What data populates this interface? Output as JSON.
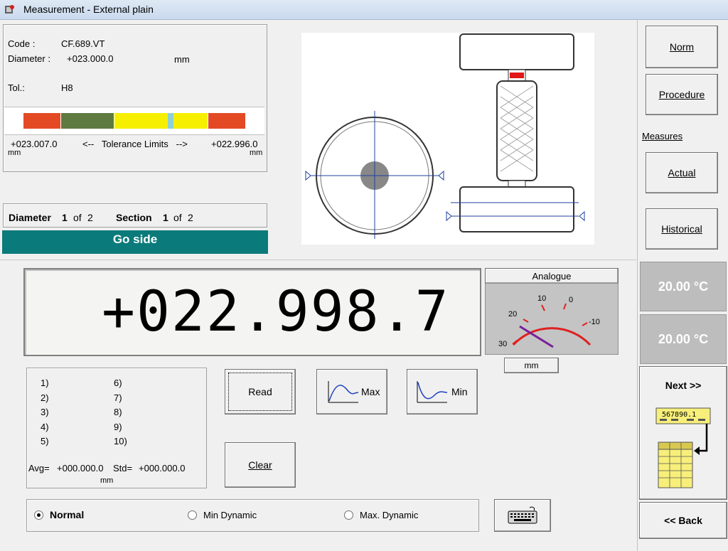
{
  "window": {
    "title": "Measurement - External plain"
  },
  "part": {
    "code_label": "Code :",
    "code_value": "CF.689.VT",
    "diameter_label": "Diameter :",
    "diameter_value": "+023.000.0",
    "diameter_unit": "mm",
    "tol_label": "Tol.:",
    "tol_value": "H8"
  },
  "tolerance": {
    "left_value": "+023.007.0",
    "left_unit": "mm",
    "middle_label": "<--   Tolerance Limits   -->",
    "right_value": "+022.996.0",
    "right_unit": "mm",
    "colors": {
      "red": "#e34a24",
      "green": "#5e7a41",
      "yellow": "#f7ef00",
      "cyan": "#8ed0d4",
      "frame": "#ffffff"
    }
  },
  "section": {
    "diameter_label": "Diameter",
    "diameter_num": "1",
    "of1": "of",
    "diameter_total": "2",
    "section_label": "Section",
    "section_num": "1",
    "of2": "of",
    "section_total": "2"
  },
  "go_side": {
    "label": "Go side",
    "color": "#0b7a7a"
  },
  "reading": {
    "value": "+022.998.7"
  },
  "analogue": {
    "title": "Analogue",
    "unit": "mm",
    "scale_labels": [
      "30",
      "20",
      "10",
      "0",
      "-10"
    ],
    "gauge_color": "#e02020",
    "needle_color": "#7a1f9a"
  },
  "readings_list": {
    "col1": [
      "1)",
      "2)",
      "3)",
      "4)",
      "5)"
    ],
    "col2": [
      "6)",
      "7)",
      "8)",
      "9)",
      "10)"
    ],
    "avg_label": "Avg=",
    "avg_value": "+000.000.0",
    "std_label": "Std=",
    "std_value": "+000.000.0",
    "unit": "mm"
  },
  "buttons": {
    "read": "Read",
    "max": "Max",
    "min": "Min",
    "clear": "Clear",
    "norm": "Norm",
    "procedure": "Procedure",
    "actual": "Actual",
    "historical": "Historical",
    "next": "Next >>",
    "back": "<< Back"
  },
  "measures_label": "Measures",
  "temperatures": [
    "20.00 °C",
    "20.00 °C"
  ],
  "mode": {
    "options": [
      "Normal",
      "Min Dynamic",
      "Max. Dynamic"
    ],
    "selected": "Normal"
  },
  "counter_icon": {
    "digits": "567890.1"
  }
}
